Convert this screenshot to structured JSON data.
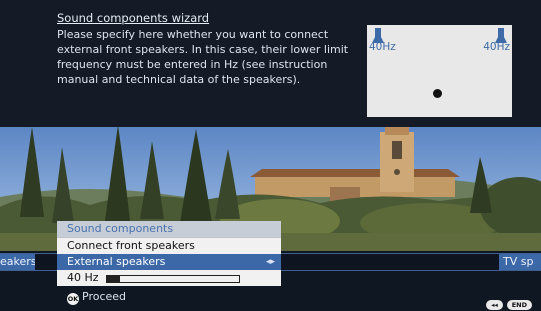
{
  "wizard": {
    "title": "Sound components wizard",
    "description": "Please specify here whether you want to connect external front speakers. In this case, their lower limit frequency must be entered in Hz (see instruction manual and technical data of the speakers).",
    "left_speaker_freq": "40Hz",
    "right_speaker_freq": "40Hz"
  },
  "menubar": {
    "left_item": "eakers",
    "right_item": "TV sp"
  },
  "popup": {
    "header": "Sound components",
    "option_connect": "Connect front speakers",
    "option_external": "External speakers",
    "external_arrows": "◂▸",
    "frequency_value": "40 Hz",
    "frequency_slider_fraction": 0.1
  },
  "footer": {
    "ok_badge": "OK",
    "proceed_label": "Proceed",
    "back_key": "◂◂",
    "end_key": "END"
  },
  "colors": {
    "accent": "#3d68a8",
    "panel_bg": "#141b26"
  }
}
